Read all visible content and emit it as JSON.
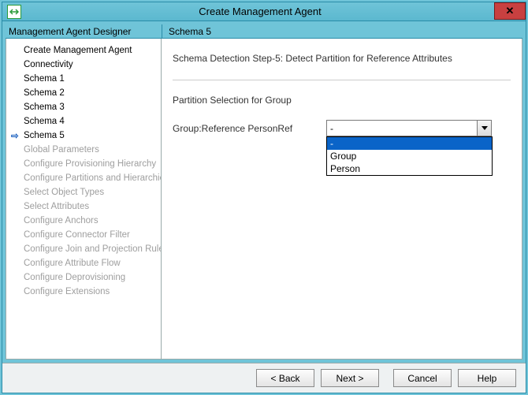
{
  "titlebar": {
    "title": "Create Management Agent",
    "close": "✕"
  },
  "headers": {
    "left": "Management Agent Designer",
    "right": "Schema 5"
  },
  "sidebar": {
    "items": [
      {
        "label": "Create Management Agent",
        "disabled": false,
        "current": false
      },
      {
        "label": "Connectivity",
        "disabled": false,
        "current": false
      },
      {
        "label": "Schema 1",
        "disabled": false,
        "current": false
      },
      {
        "label": "Schema 2",
        "disabled": false,
        "current": false
      },
      {
        "label": "Schema 3",
        "disabled": false,
        "current": false
      },
      {
        "label": "Schema 4",
        "disabled": false,
        "current": false
      },
      {
        "label": "Schema 5",
        "disabled": false,
        "current": true
      },
      {
        "label": "Global Parameters",
        "disabled": true,
        "current": false
      },
      {
        "label": "Configure Provisioning Hierarchy",
        "disabled": true,
        "current": false
      },
      {
        "label": "Configure Partitions and Hierarchies",
        "disabled": true,
        "current": false
      },
      {
        "label": "Select Object Types",
        "disabled": true,
        "current": false
      },
      {
        "label": "Select Attributes",
        "disabled": true,
        "current": false
      },
      {
        "label": "Configure Anchors",
        "disabled": true,
        "current": false
      },
      {
        "label": "Configure Connector Filter",
        "disabled": true,
        "current": false
      },
      {
        "label": "Configure Join and Projection Rules",
        "disabled": true,
        "current": false
      },
      {
        "label": "Configure Attribute Flow",
        "disabled": true,
        "current": false
      },
      {
        "label": "Configure Deprovisioning",
        "disabled": true,
        "current": false
      },
      {
        "label": "Configure Extensions",
        "disabled": true,
        "current": false
      }
    ]
  },
  "main": {
    "step_title": "Schema Detection Step-5: Detect Partition for Reference Attributes",
    "section_label": "Partition Selection for Group",
    "field_label": "Group:Reference PersonRef",
    "combo_value": "-",
    "dropdown": {
      "options": [
        "-",
        "Group",
        "Person"
      ],
      "selected_index": 0
    }
  },
  "footer": {
    "back": "<  Back",
    "next": "Next  >",
    "cancel": "Cancel",
    "help": "Help"
  }
}
